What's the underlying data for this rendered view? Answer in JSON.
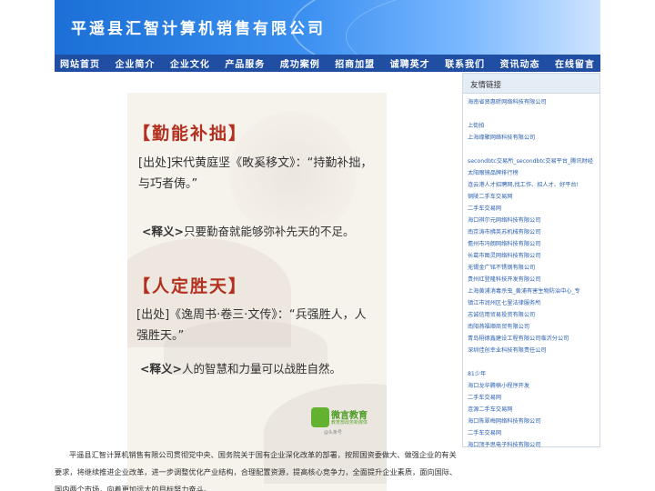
{
  "header": {
    "company_title": "平遥县汇智计算机销售有限公司"
  },
  "nav": {
    "items": [
      "网站首页",
      "企业简介",
      "企业文化",
      "产品服务",
      "成功案例",
      "招商加盟",
      "诚聘英才",
      "联系我们",
      "资讯动态",
      "在线留言"
    ]
  },
  "article_image": {
    "section1": {
      "title": "勤能补拙",
      "source_label": "[出处]",
      "source_text": "宋代黄庭坚《畋奚移文》：",
      "quote_line1": "“持勤补拙，",
      "quote_line2": "与巧者俦。”",
      "meaning_label": "<释义>",
      "meaning_text": "只要勤奋就能够弥补先天的不足。"
    },
    "section2": {
      "title": "人定胜天",
      "source_label": "[出处]",
      "source_text": "《逸周书·卷三·文传》：",
      "quote_line1": "“兵强胜人，人",
      "quote_line2": "强胜天。”",
      "meaning_label": "<释义>",
      "meaning_text": "人的智慧和力量可以战胜自然。"
    },
    "watermark": {
      "name": "微言教育",
      "sub": "教育部政务新媒体",
      "brand": "@头条号"
    }
  },
  "body_text": "平遥县汇智计算机销售有限公司贯彻党中央、国务院关于国有企业深化改革的部署，按照国资委做大、做强企业的有关要求，将继续推进企业改革，进一步调整优化产业结构，合理配置资源，提高核心竞争力，全面提升企业素质，面向国际、国内两个市场，向着更加远大的目标努力奋斗。",
  "sidebar": {
    "title": "友情链接",
    "links": [
      "海南省贤惠昕网络科技有限公司",
      "",
      "上街拍",
      "上海缘聚网络科技有限公司",
      "",
      "secondbtc交易所_secondbtc交易平台_腾讯财经",
      "太阳眼镜品牌排行榜",
      "连云港人才招聘网,找工作、招人才、好平台!",
      "铜陵二手车交易网",
      "二手车交易网",
      "海口祺尔元网络科技有限公司",
      "南京涛市拂英苏机械有限公司",
      "儋州市冯朗网络科技有限公司",
      "长葛市图灵网络科技有限公司",
      "无锡金广铭不锈钢有限公司",
      "贵州红登隆科技开发有限公司",
      "上海黄浦消毒杀虫_黄浦有害生物防治中心_专",
      "镇江市润州区七里法律服务所",
      "志诚信用贸易投资有限公司",
      "南阳燕福顺商贸有限公司",
      "青岛栩德鑫建设工程有限公司临沂分公司",
      "深圳佳创幸业科技有限责任公司",
      "",
      "81少年",
      "海口龙华腾楠小程序开发",
      "二手车交易网",
      "连源二手车交易网",
      "海口陈翠梅网络科技有限公司",
      "二手车交易网",
      "海口顶予思电子科技有限公司"
    ]
  }
}
